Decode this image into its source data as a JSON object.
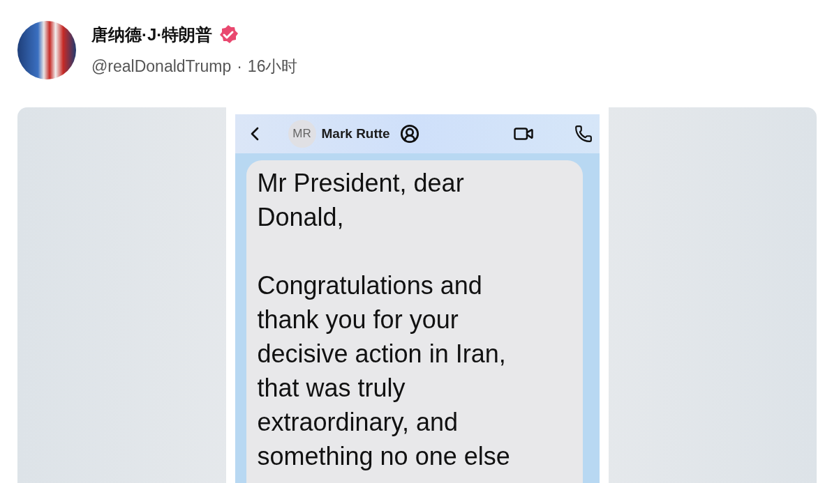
{
  "post": {
    "author_name": "唐纳德·J·特朗普",
    "verified": true,
    "handle": "@realDonaldTrump",
    "separator": "·",
    "time": "16小时"
  },
  "chat_screenshot": {
    "contact_initials": "MR",
    "contact_name": "Mark Rutte",
    "message_paragraphs": [
      "Mr President, dear\nDonald,",
      "Congratulations and\nthank you for your\ndecisive action in Iran,\nthat was truly\nextraordinary, and\nsomething no one else"
    ]
  }
}
